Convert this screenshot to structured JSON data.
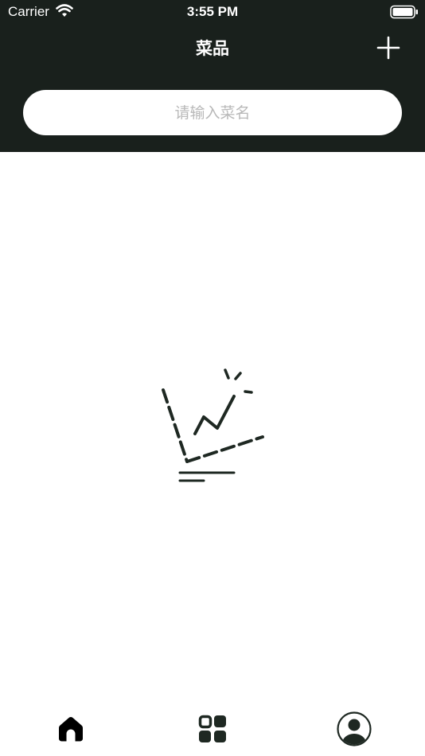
{
  "status_bar": {
    "carrier": "Carrier",
    "time": "3:55 PM"
  },
  "nav": {
    "title": "菜品"
  },
  "search": {
    "placeholder": "请输入菜名",
    "value": ""
  },
  "icons": {
    "add": "plus-icon",
    "empty_state": "empty-chart-illustration",
    "tabs": [
      "home-icon",
      "grid-icon",
      "user-icon"
    ]
  },
  "colors": {
    "header_bg": "#19201c",
    "accent": "#1e2822",
    "background": "#ffffff",
    "placeholder": "#b8b8b8"
  }
}
